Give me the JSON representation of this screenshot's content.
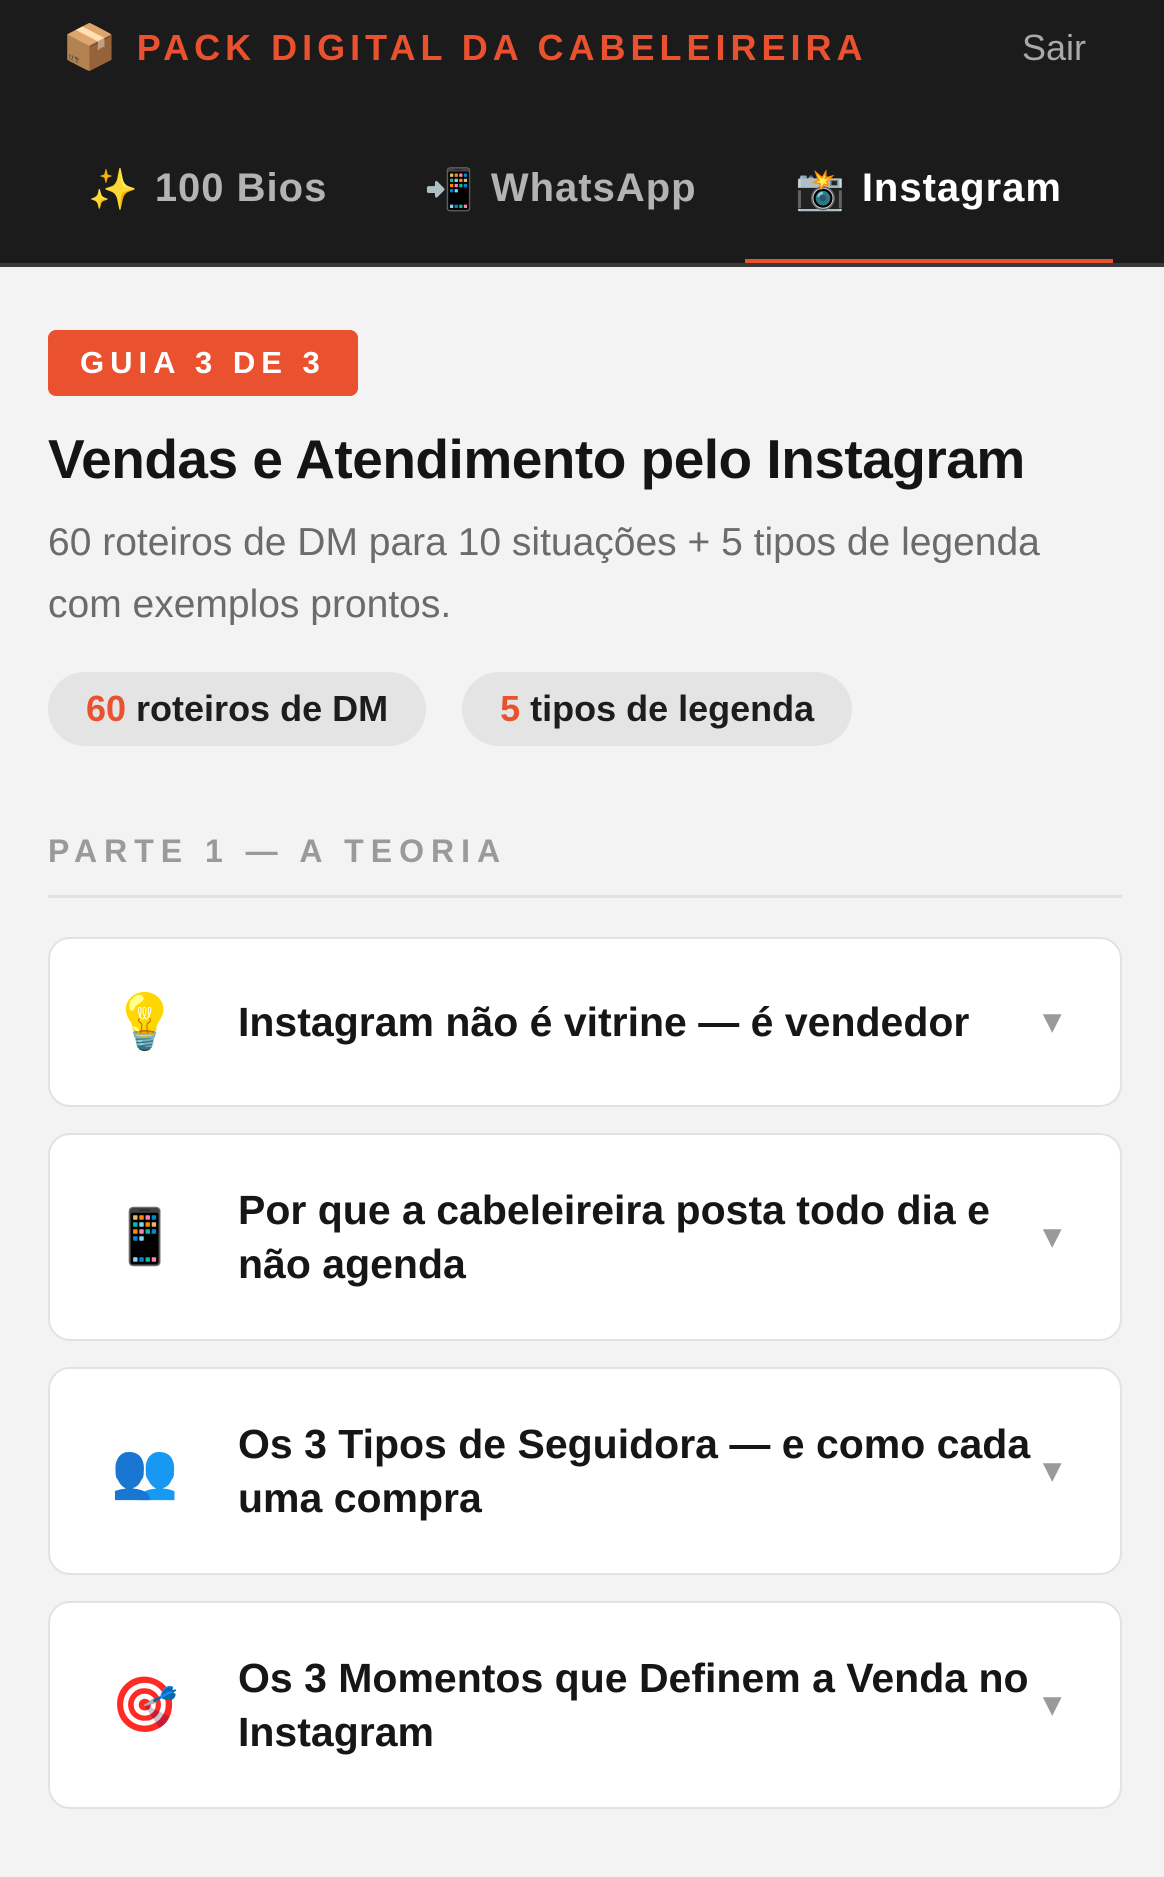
{
  "header": {
    "brand_icon": "📦",
    "brand_title": "PACK DIGITAL DA CABELEIREIRA",
    "logout_label": "Sair",
    "tabs": [
      {
        "icon": "✨",
        "label": "100 Bios",
        "active": false
      },
      {
        "icon": "📲",
        "label": "WhatsApp",
        "active": false
      },
      {
        "icon": "📸",
        "label": "Instagram",
        "active": true
      }
    ]
  },
  "main": {
    "badge": "GUIA 3 DE 3",
    "title": "Vendas e Atendimento pelo Instagram",
    "subtitle": "60 roteiros de DM para 10 situações + 5 tipos de legenda com exemplos prontos.",
    "chips": [
      {
        "number": "60",
        "label": "roteiros de DM"
      },
      {
        "number": "5",
        "label": "tipos de legenda"
      }
    ],
    "section_label": "PARTE 1 — A TEORIA",
    "cards": [
      {
        "icon": "💡",
        "title": "Instagram não é vitrine — é vendedor",
        "chevron": "▼"
      },
      {
        "icon": "📱",
        "title": "Por que a cabeleireira posta todo dia e não agenda",
        "chevron": "▼"
      },
      {
        "icon": "👥",
        "title": "Os 3 Tipos de Seguidora — e como cada uma compra",
        "chevron": "▼"
      },
      {
        "icon": "🎯",
        "title": "Os 3 Momentos que Definem a Venda no Instagram",
        "chevron": "▼"
      }
    ]
  },
  "colors": {
    "accent": "#e9512f",
    "header_bg": "#1b1b1b",
    "page_bg": "#f3f3f3"
  }
}
